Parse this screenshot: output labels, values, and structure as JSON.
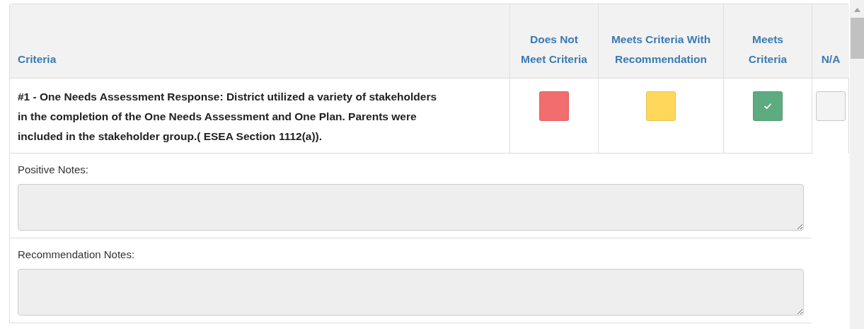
{
  "table": {
    "columns": [
      {
        "label": "Criteria"
      },
      {
        "label": "Does Not Meet Criteria"
      },
      {
        "label": "Meets Criteria With Recommendation"
      },
      {
        "label": "Meets Criteria"
      },
      {
        "label": "N/A"
      }
    ],
    "rows": [
      {
        "text": "#1 - One Needs Assessment Response: District utilized a variety of stakeholders in the completion of the One Needs Assessment and One Plan. Parents were included in the stakeholder group.( ESEA Section 1112(a)).",
        "options": [
          {
            "color": "#f26d6d",
            "checked": false
          },
          {
            "color": "#fed75b",
            "checked": false
          },
          {
            "color": "#5dab81",
            "checked": true
          },
          {
            "color": "#f4f4f4",
            "checked": false
          }
        ],
        "notes": [
          {
            "label": "Positive Notes:",
            "disabled": true
          },
          {
            "label": "Recommendation Notes:",
            "disabled": true
          }
        ]
      }
    ]
  }
}
